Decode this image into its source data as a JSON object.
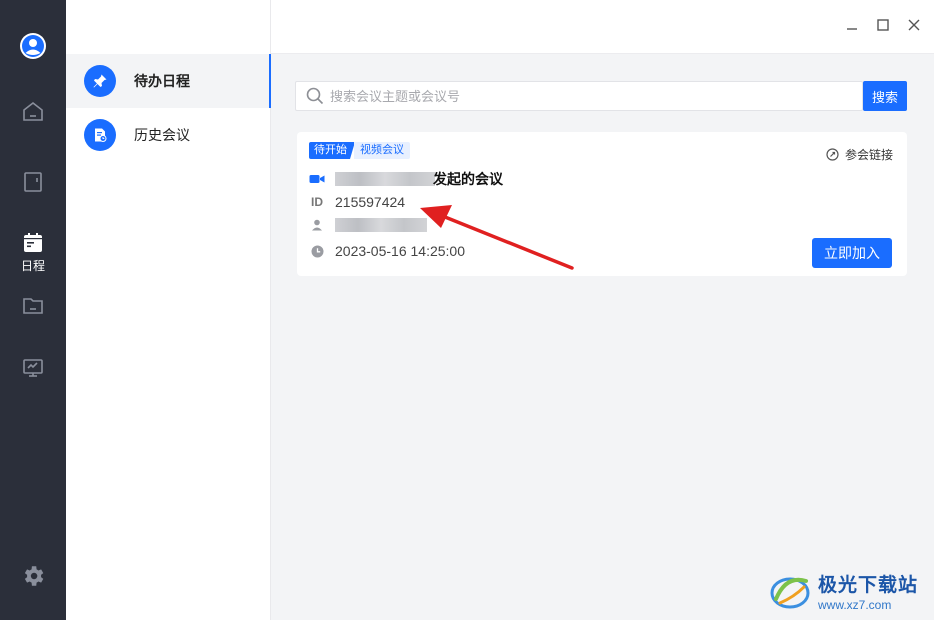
{
  "window": {
    "controls": [
      "minimize",
      "maximize",
      "close"
    ]
  },
  "rail": {
    "items": [
      {
        "id": "avatar",
        "icon": "user-icon"
      },
      {
        "id": "home",
        "icon": "home-icon"
      },
      {
        "id": "book",
        "icon": "book-icon"
      },
      {
        "id": "schedule",
        "icon": "calendar-icon",
        "label": "日程",
        "active": true
      },
      {
        "id": "files",
        "icon": "folder-icon"
      },
      {
        "id": "screen",
        "icon": "monitor-icon"
      },
      {
        "id": "settings",
        "icon": "gear-icon"
      }
    ]
  },
  "subnav": {
    "items": [
      {
        "label": "待办日程",
        "icon": "pin-icon",
        "active": true
      },
      {
        "label": "历史会议",
        "icon": "history-doc-icon",
        "active": false
      }
    ]
  },
  "search": {
    "placeholder": "搜索会议主题或会议号",
    "value": "",
    "button_label": "搜索"
  },
  "meeting": {
    "status_tag": "待开始",
    "type_tag": "视频会议",
    "join_link_label": "参会链接",
    "title_suffix": "发起的会议",
    "id_label": "ID",
    "id": "215597424",
    "time": "2023-05-16 14:25:00",
    "join_button": "立即加入"
  },
  "watermark": {
    "brand": "极光下载站",
    "url": "www.xz7.com"
  },
  "colors": {
    "accent": "#1a6dff",
    "rail_bg": "#2b2f3a",
    "main_bg": "#f3f4f6",
    "annotation_arrow": "#e02020"
  }
}
